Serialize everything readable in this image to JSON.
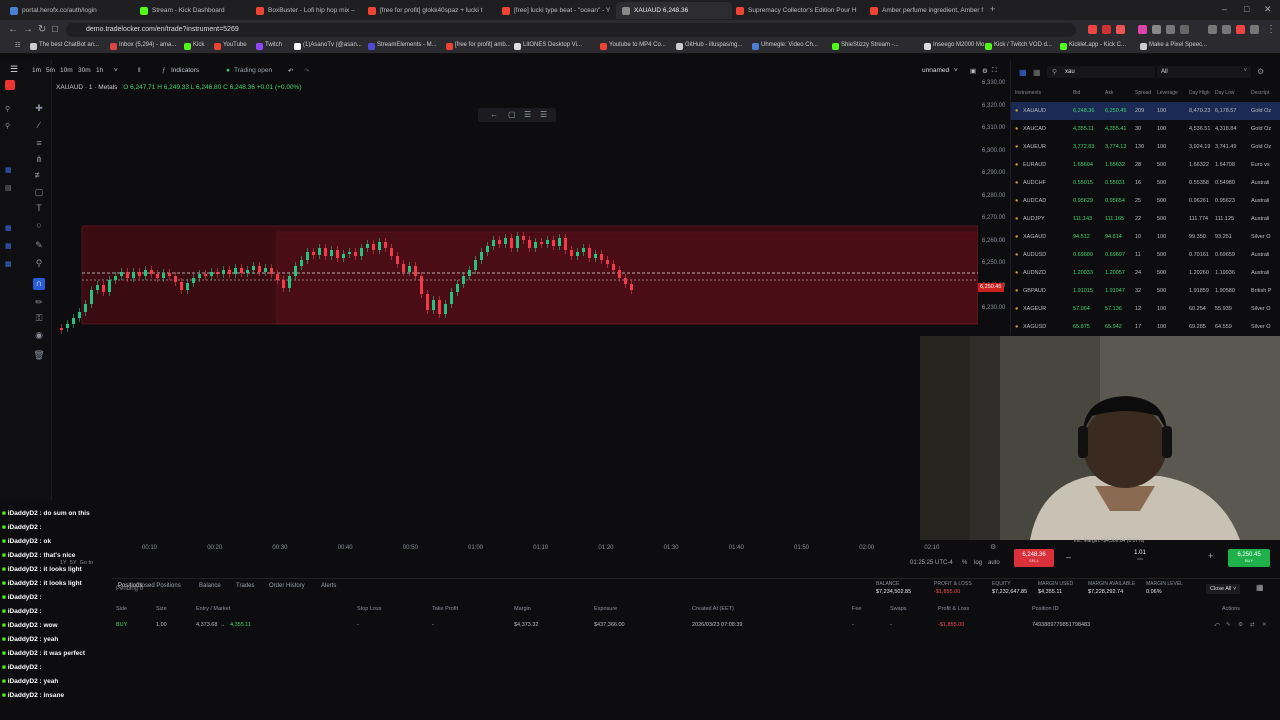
{
  "browser": {
    "tabs": [
      {
        "label": "portal.herofx.co/auth/login",
        "color": "#4a7fd4"
      },
      {
        "label": "Stream - Kick Dashboard",
        "color": "#53fc18"
      },
      {
        "label": "BoxBuster - Lofi hip hop mix – Stre",
        "color": "#e43"
      },
      {
        "label": "[free for profit] glokk40spaz + lucki t",
        "color": "#e43"
      },
      {
        "label": "[free] lucki type beat - \"ocean\" - You",
        "color": "#e43"
      },
      {
        "label": "XAUAUD 6,248.36",
        "color": "#888",
        "active": true
      },
      {
        "label": "Supremacy Collector's Edition Pour H",
        "color": "#e43"
      },
      {
        "label": "Amber perfume ingredient, Amber f",
        "color": "#e43"
      }
    ],
    "url": "demo.tradelocker.com/en/trade?instrument=5269",
    "bookmarks": [
      {
        "label": "The best ChatBot an...",
        "color": "#ccc"
      },
      {
        "label": "Inbox (5,294) - ama...",
        "color": "#d44"
      },
      {
        "label": "Kick",
        "color": "#53fc18"
      },
      {
        "label": "YouTube",
        "color": "#e43"
      },
      {
        "label": "Twitch",
        "color": "#9146ff"
      },
      {
        "label": "(1)AsanoTv (@asan...",
        "color": "#fff"
      },
      {
        "label": "StreamElements - M...",
        "color": "#4b4bd4"
      },
      {
        "label": "[free for profit] amb...",
        "color": "#e43"
      },
      {
        "label": "LitONES Desktop Vi...",
        "color": "#ddd"
      },
      {
        "label": "Youtube to MP4 Co...",
        "color": "#e43"
      },
      {
        "label": "GitHub - illuspas/ng...",
        "color": "#ccc"
      },
      {
        "label": "Uhmegle: Video Ch...",
        "color": "#4a7fd4"
      },
      {
        "label": "ShieStizzy Stream -...",
        "color": "#53fc18"
      },
      {
        "label": "Inseego M2000 Mo...",
        "color": "#ddd"
      },
      {
        "label": "Kick / Twitch VOD d...",
        "color": "#53fc18"
      },
      {
        "label": "Kicklet.app - Kick C...",
        "color": "#53fc18"
      },
      {
        "label": "Make a Pixel Speec...",
        "color": "#ccc"
      }
    ]
  },
  "chart_toolbar": {
    "timeframes": [
      "1m",
      "5m",
      "10m",
      "30m",
      "1h"
    ],
    "indicators": "Indicators",
    "trading_status": "Trading open",
    "layout_name": "unnamed"
  },
  "chart": {
    "symbol_line": "XAUAUD · 1 · Metals",
    "ohlc": "O 6,247.71  H 6,249.33  L 6,246.80  C 6,248.36  +0.01 (+0.00%)",
    "y_ticks": [
      "6,330.00",
      "6,320.00",
      "6,310.00",
      "6,300.00",
      "6,290.00",
      "6,280.00",
      "6,270.00",
      "6,260.00",
      "6,250.00",
      "6,240.00",
      "6,230.00"
    ],
    "x_ticks": [
      "00:10",
      "00:20",
      "00:30",
      "00:40",
      "00:50",
      "01:00",
      "01:10",
      "01:20",
      "01:30",
      "01:40",
      "01:50",
      "02:00",
      "02:10"
    ],
    "price_tag": "6,250.45",
    "time_display": "01:25:25 UTC-4",
    "scale_opts": [
      "%",
      "log",
      "auto"
    ],
    "range_opts": [
      "1D",
      "5D",
      "1M",
      "3M",
      "6M",
      "1Y",
      "5Y",
      "Go to"
    ]
  },
  "watchlist": {
    "search": "xau",
    "filter": "All",
    "headers": [
      "Instruments",
      "Bid",
      "Ask",
      "Spread",
      "Leverage",
      "Day High",
      "Day Low",
      "Descript"
    ],
    "rows": [
      [
        "XAUAUD",
        "6,248.36",
        "6,250.45",
        "209",
        "100",
        "8,470.23",
        "6,178.57",
        "Gold Oz"
      ],
      [
        "XAUCAD",
        "4,355.11",
        "4,355.41",
        "30",
        "100",
        "4,536.51",
        "4,318.84",
        "Gold Oz"
      ],
      [
        "XAUEUR",
        "3,772.83",
        "3,774.13",
        "130",
        "100",
        "3,924.19",
        "3,741.49",
        "Gold Oz"
      ],
      [
        "EURAUD",
        "1.65604",
        "1.65632",
        "28",
        "500",
        "1.66322",
        "1.64708",
        "Euro vs"
      ],
      [
        "AUDCHF",
        "0.55015",
        "0.55031",
        "16",
        "500",
        "0.55358",
        "0.54980",
        "Australi"
      ],
      [
        "AUDCAD",
        "0.95629",
        "0.95654",
        "25",
        "500",
        "0.96261",
        "0.95623",
        "Australi"
      ],
      [
        "AUDJPY",
        "111.143",
        "111.165",
        "22",
        "500",
        "111.774",
        "111.125",
        "Australi"
      ],
      [
        "XAGAUD",
        "94.512",
        "94.614",
        "10",
        "100",
        "99.350",
        "93.251",
        "Silver O"
      ],
      [
        "AUDUSD",
        "0.69680",
        "0.69697",
        "11",
        "500",
        "0.70161",
        "0.69659",
        "Australi"
      ],
      [
        "AUDNZD",
        "1.20033",
        "1.20057",
        "24",
        "500",
        "1.20260",
        "1.19936",
        "Australi"
      ],
      [
        "GBPAUD",
        "1.91015",
        "1.91047",
        "32",
        "500",
        "1.91859",
        "1.90580",
        "British P"
      ],
      [
        "XAGEUR",
        "57.064",
        "57.136",
        "12",
        "100",
        "60.254",
        "55.939",
        "Silver O"
      ],
      [
        "XAGUSD",
        "65.875",
        "65.942",
        "17",
        "100",
        "69.285",
        "64.559",
        "Silver O"
      ]
    ]
  },
  "chat": [
    {
      "user": "iDaddyD2",
      "msg": "do sum on this"
    },
    {
      "user": "iDaddyD2",
      "msg": ""
    },
    {
      "user": "iDaddyD2",
      "msg": "ok"
    },
    {
      "user": "iDaddyD2",
      "msg": "that's nice"
    },
    {
      "user": "iDaddyD2",
      "msg": "it looks light"
    },
    {
      "user": "iDaddyD2",
      "msg": "it looks light"
    },
    {
      "user": "iDaddyD2",
      "msg": ""
    },
    {
      "user": "iDaddyD2",
      "msg": ""
    },
    {
      "user": "iDaddyD2",
      "msg": "wow"
    },
    {
      "user": "iDaddyD2",
      "msg": "yeah"
    },
    {
      "user": "iDaddyD2",
      "msg": "it was perfect"
    },
    {
      "user": "iDaddyD2",
      "msg": ""
    },
    {
      "user": "iDaddyD2",
      "msg": "yeah"
    },
    {
      "user": "iDaddyD2",
      "msg": "insane"
    }
  ],
  "trade_panel": {
    "sell_price": "6,248.36",
    "sell_label": "SELL",
    "buy_price": "6,250.45",
    "buy_label": "BUY",
    "lots": "1.01",
    "lots_label": "lots",
    "init_margin": "Init. Margin: -$4,306.04 (0.07%)"
  },
  "bottom_panel": {
    "tabs": [
      "Positions",
      "Pending",
      "Closed Positions",
      "Balance",
      "Trades",
      "Order History",
      "Alerts"
    ],
    "pending_count": "0",
    "stats": [
      {
        "label": "BALANCE",
        "value": "$7,234,502.85"
      },
      {
        "label": "PROFIT & LOSS",
        "value": "-$1,855.00"
      },
      {
        "label": "EQUITY",
        "value": "$7,232,647.85"
      },
      {
        "label": "MARGIN USED",
        "value": "$4,355.11"
      },
      {
        "label": "MARGIN AVAILABLE",
        "value": "$7,228,292.74"
      },
      {
        "label": "MARGIN LEVEL",
        "value": "0.06%"
      }
    ],
    "close_all": "Close All",
    "columns": [
      "Instrument",
      "Side",
      "Size",
      "Entry / Market",
      "Stop Loss",
      "Take Profit",
      "Margin",
      "Exposure",
      "Created At (EET)",
      "Fee",
      "Swaps",
      "Profit & Loss",
      "Position ID",
      "Actions"
    ],
    "row": {
      "side": "BUY",
      "size": "1.00",
      "entry": "4,373.68",
      "market": "4,355.11",
      "stop": "-",
      "take": "-",
      "margin": "$4,373.32",
      "exposure": "$437,366.00",
      "created": "2026/03/23 07:08:39",
      "fee": "-",
      "swaps": "-",
      "pnl": "-$1,855.00",
      "position_id": "749388977985179848​3"
    }
  }
}
